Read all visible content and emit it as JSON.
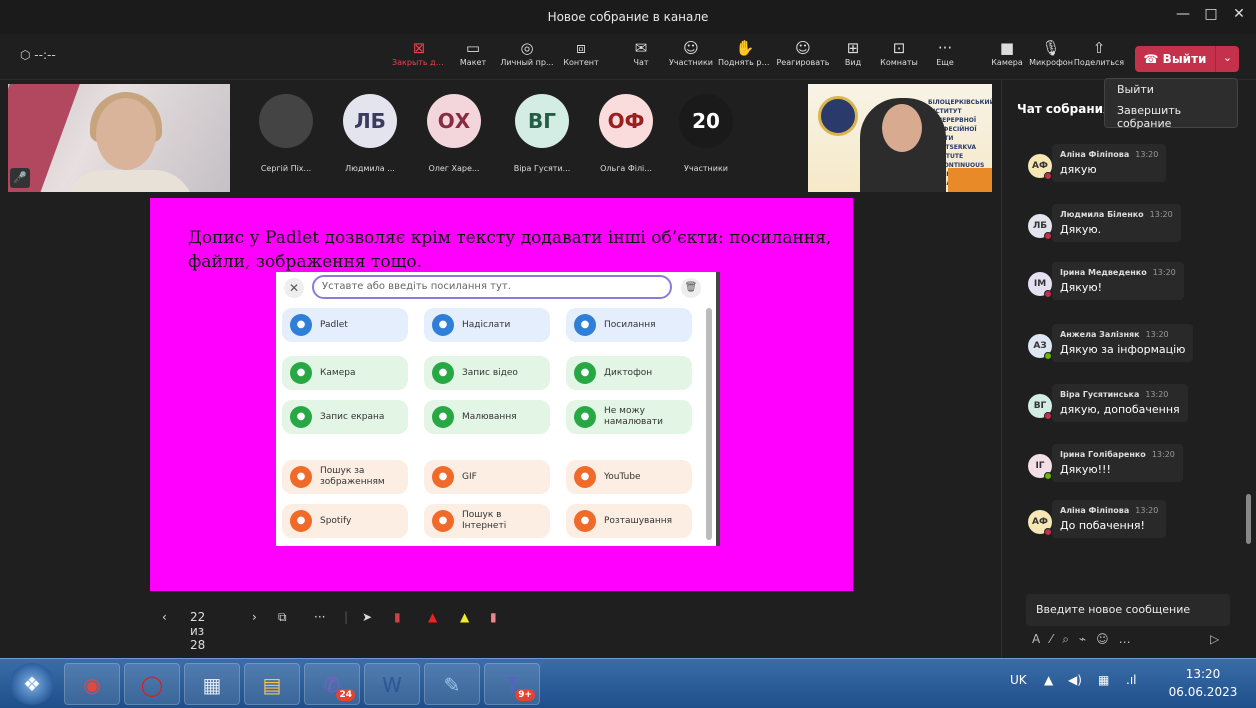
{
  "window": {
    "title": "Новое собрание в канале",
    "controls": [
      "—",
      "□",
      "✕"
    ],
    "timer": "--:--"
  },
  "toolbar": {
    "items": [
      {
        "label": "Закрыть до...",
        "icon": "close-share-icon"
      },
      {
        "label": "Макет",
        "icon": "layout-icon"
      },
      {
        "label": "Личный пр...",
        "icon": "private-view-icon"
      },
      {
        "label": "Контент",
        "icon": "content-icon"
      },
      {
        "label": "Чат",
        "icon": "chat-icon"
      },
      {
        "label": "Участники",
        "icon": "participants-icon"
      },
      {
        "label": "Поднять руку",
        "icon": "raise-hand-icon"
      },
      {
        "label": "Реагировать",
        "icon": "react-icon"
      },
      {
        "label": "Вид",
        "icon": "view-icon"
      },
      {
        "label": "Комнаты",
        "icon": "rooms-icon"
      },
      {
        "label": "Еще",
        "icon": "more-icon"
      },
      {
        "label": "Камера",
        "icon": "camera-icon"
      },
      {
        "label": "Микрофон",
        "icon": "microphone-icon"
      },
      {
        "label": "Поделиться",
        "icon": "share-icon"
      }
    ],
    "leave_label": "Выйти",
    "leave_menu": [
      "Выйти",
      "Завершить собрание"
    ]
  },
  "participants": [
    {
      "initials": "",
      "name": "Сергій Піх...",
      "color": "#444444"
    },
    {
      "initials": "ЛБ",
      "name": "Людмила ...",
      "color": "#e4e4ef",
      "text": "#3b3b60"
    },
    {
      "initials": "ОХ",
      "name": "Олег Харе...",
      "color": "#f3d6dc",
      "text": "#8a2b43"
    },
    {
      "initials": "ВГ",
      "name": "Віра Гусяти...",
      "color": "#d3ede4",
      "text": "#245c48"
    },
    {
      "initials": "ОФ",
      "name": "Ольга Філі...",
      "color": "#fbdcdc",
      "text": "#9a2020"
    },
    {
      "initials": "20",
      "name": "Участники",
      "color": "#1a1a1a",
      "text": "#ffffff"
    }
  ],
  "video_right_text": [
    "БІЛОЦЕРКІВСЬКИЙ ІНСТИТУТ",
    "НЕПЕРЕРВНОЇ ПРОФЕСІЙНОЇ ОСВІТИ",
    "BILA TSERKVA INSTITUTE",
    "OF CONTINUOUS PROFESSIONAL",
    "EDUCATION"
  ],
  "slide": {
    "text": "Допис у Padlet дозволяє крім тексту додавати інші об’єкти: посилання, файли, зображення тощо.",
    "padlet": {
      "placeholder": "Уставте або введіть посилання тут.",
      "cards": [
        {
          "label": "Padlet",
          "color": "blue",
          "icon": "padlet-icon"
        },
        {
          "label": "Надіслати",
          "color": "blue",
          "icon": "upload-icon"
        },
        {
          "label": "Посилання",
          "color": "blue",
          "icon": "link-icon"
        },
        {
          "label": "Камера",
          "color": "green",
          "icon": "camera-icon"
        },
        {
          "label": "Запис відео",
          "color": "green",
          "icon": "video-icon"
        },
        {
          "label": "Диктофон",
          "color": "green",
          "icon": "mic-icon"
        },
        {
          "label": "Запис екрана",
          "color": "green",
          "icon": "screen-record-icon"
        },
        {
          "label": "Малювання",
          "color": "green",
          "icon": "draw-icon"
        },
        {
          "label": "Не можу намалювати",
          "color": "green",
          "icon": "sparkle-icon"
        },
        {
          "label": "Пошук за зображенням",
          "color": "orng",
          "icon": "image-search-icon"
        },
        {
          "label": "GIF",
          "color": "orng",
          "icon": "gif-icon"
        },
        {
          "label": "YouTube",
          "color": "orng",
          "icon": "youtube-icon"
        },
        {
          "label": "Spotify",
          "color": "orng",
          "icon": "spotify-icon"
        },
        {
          "label": "Пошук в Інтернеті",
          "color": "orng",
          "icon": "web-search-icon"
        },
        {
          "label": "Розташування",
          "color": "orng",
          "icon": "location-icon"
        }
      ]
    },
    "counter": "22 из 28"
  },
  "chat": {
    "header": "Чат собрания",
    "messages": [
      {
        "initials": "АФ",
        "name": "Аліна Філіпова",
        "time": "13:20",
        "text": "дякую",
        "avatar": "#f6e7b5",
        "status": "#c4314b"
      },
      {
        "initials": "ЛБ",
        "name": "Людмила Біленко",
        "time": "13:20",
        "text": "Дякую.",
        "avatar": "#e4e4ef",
        "status": "#c4314b"
      },
      {
        "initials": "ІМ",
        "name": "Ірина Медведенко",
        "time": "13:20",
        "text": "Дякую!",
        "avatar": "#e6e0f3",
        "status": "#c4314b"
      },
      {
        "initials": "АЗ",
        "name": "Анжела Залізняк",
        "time": "13:20",
        "text": "Дякую за інформацію",
        "avatar": "#dfe6f3",
        "status": "#6bb700"
      },
      {
        "initials": "ВГ",
        "name": "Віра Гусятинська",
        "time": "13:20",
        "text": "дякую, допобачення",
        "avatar": "#d3ede4",
        "status": "#c4314b"
      },
      {
        "initials": "ІГ",
        "name": "Ірина Голібаренко",
        "time": "13:20",
        "text": "Дякую!!!",
        "avatar": "#f3e0e6",
        "status": "#6bb700"
      },
      {
        "initials": "АФ",
        "name": "Аліна Філіпова",
        "time": "13:20",
        "text": "До побачення!",
        "avatar": "#f6e7b5",
        "status": "#c4314b"
      }
    ],
    "input_placeholder": "Введите новое сообщение"
  },
  "taskbar": {
    "apps": [
      {
        "name": "chrome-icon",
        "badge": ""
      },
      {
        "name": "opera-icon",
        "badge": ""
      },
      {
        "name": "calculator-icon",
        "badge": ""
      },
      {
        "name": "explorer-icon",
        "badge": ""
      },
      {
        "name": "viber-icon",
        "badge": "24"
      },
      {
        "name": "word-icon",
        "badge": ""
      },
      {
        "name": "paint-icon",
        "badge": ""
      },
      {
        "name": "teams-icon",
        "badge": "9+"
      }
    ],
    "lang": "UK",
    "time": "13:20",
    "date": "06.06.2023"
  }
}
